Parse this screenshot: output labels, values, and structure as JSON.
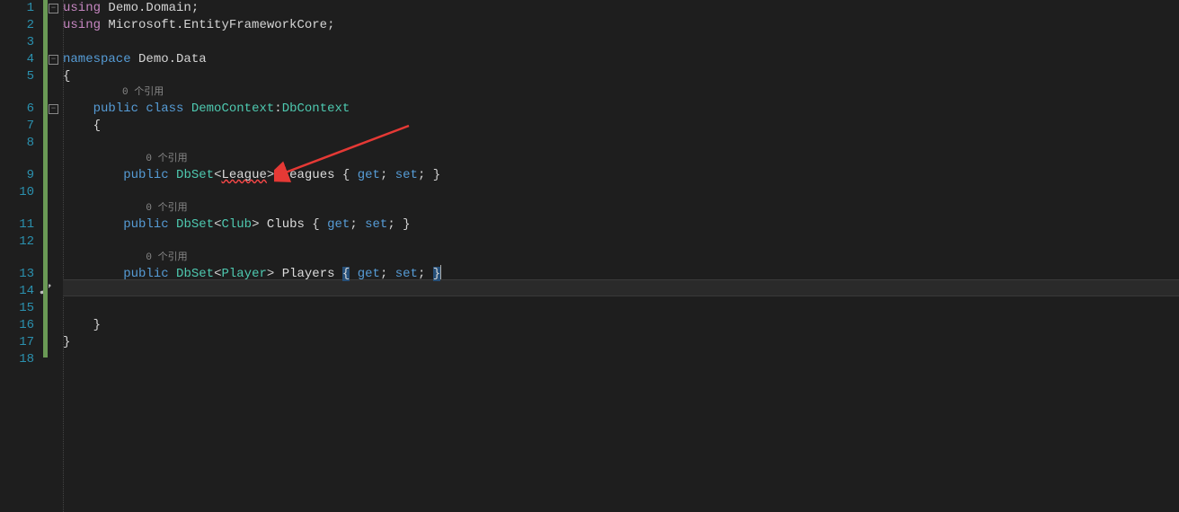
{
  "gutter": {
    "lines": [
      "1",
      "2",
      "3",
      "4",
      "5",
      "6",
      "7",
      "8",
      "9",
      "10",
      "11",
      "12",
      "13",
      "14",
      "15",
      "16",
      "17",
      "18"
    ]
  },
  "code": {
    "using1_kw": "using",
    "using1_ns": " Demo.Domain",
    "semi": ";",
    "using2_kw": "using",
    "using2_ns": " Microsoft.EntityFrameworkCore",
    "ns_kw": "namespace",
    "ns_name": " Demo.Data",
    "brace_open": "{",
    "brace_close": "}",
    "codelens_refs": "0 个引用",
    "pub": "public",
    "class_kw": " class",
    "class_name": " DemoContext",
    "colon": ":",
    "base": "DbContext",
    "dbset": "DbSet",
    "lt": "<",
    "gt": ">",
    "type_league": "League",
    "type_club": "Club",
    "type_player": "Player",
    "prop_leagues": " Leagues ",
    "prop_clubs": " Clubs ",
    "prop_players": " Players ",
    "brace_l": "{",
    "brace_r": "}",
    "get": " get",
    "set": " set",
    "sp": " ",
    "indent1": "    ",
    "indent2": "        ",
    "indent3": "            ",
    "codelens_indent2": "          ",
    "codelens_indent3": "              "
  },
  "icons": {
    "fold_minus": "−",
    "quickaction": "screwdriver-icon"
  },
  "colors": {
    "arrow": "#e53935"
  }
}
